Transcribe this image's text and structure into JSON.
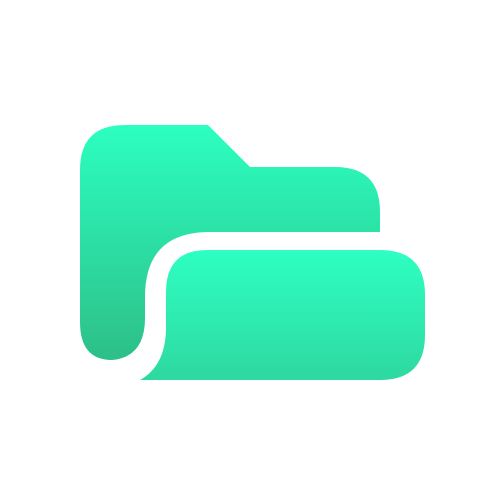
{
  "icon": {
    "name": "open-folder-icon",
    "colors": {
      "background": "#ffffff",
      "gradient_top": "#2cffc0",
      "gradient_bottom": "#2dbf88",
      "front_gradient_top": "#2effc2",
      "front_gradient_bottom": "#2ed9a0"
    }
  }
}
